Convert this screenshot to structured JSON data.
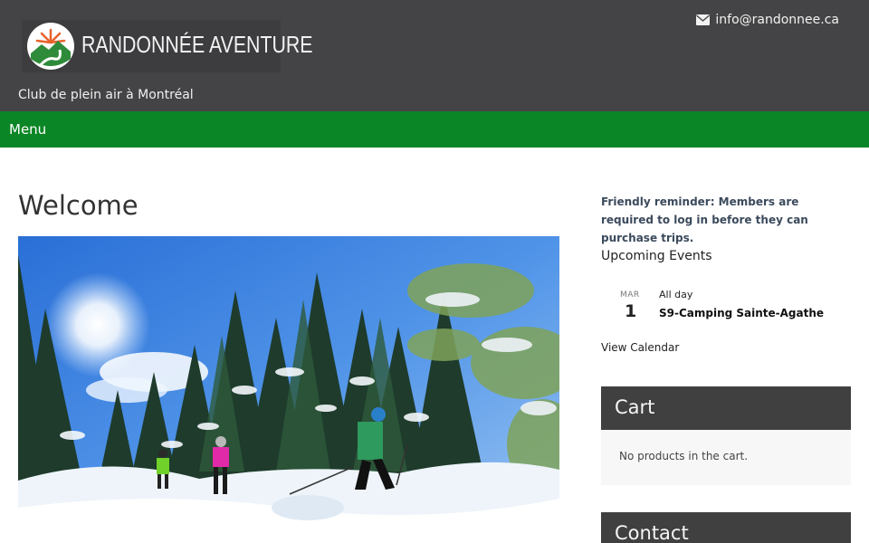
{
  "header": {
    "logo_text": "RANDONNÉE AVENTURE",
    "tagline": "Club de plein air à Montréal",
    "email": "info@randonnee.ca",
    "bg_color": "#444446"
  },
  "nav": {
    "menu_label": "Menu",
    "bg_color": "#0b8626"
  },
  "main": {
    "title": "Welcome",
    "hero_image": "winter-cross-country-skiers-photo"
  },
  "sidebar": {
    "reminder": "Friendly reminder: Members are required to log in before they can purchase trips.",
    "events": {
      "title": "Upcoming Events",
      "items": [
        {
          "month": "MAR",
          "day": "1",
          "time": "All day",
          "name": "S9-Camping Sainte-Agathe"
        }
      ],
      "view_calendar": "View Calendar"
    },
    "cart": {
      "title": "Cart",
      "empty_text": "No products in the cart."
    },
    "contact": {
      "title": "Contact"
    }
  }
}
